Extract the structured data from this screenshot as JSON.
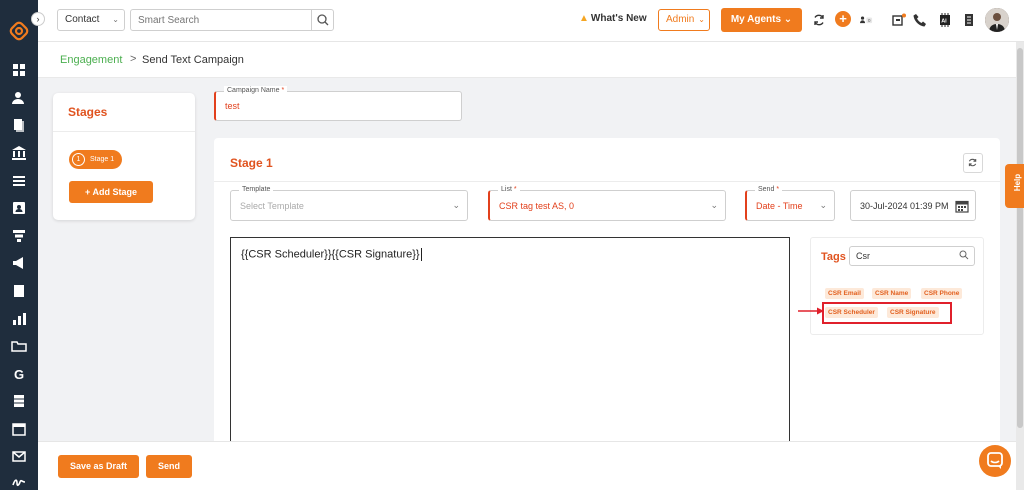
{
  "topbar": {
    "contact_select": "Contact",
    "search_placeholder": "Smart Search",
    "whats_new": "What's New",
    "admin_select": "Admin",
    "my_agents": "My Agents",
    "notification_count": "0"
  },
  "breadcrumb": {
    "parent": "Engagement",
    "separator": ">",
    "current": "Send Text Campaign"
  },
  "stages_panel": {
    "title": "Stages",
    "stage_number": "1",
    "stage_label": "Stage 1",
    "add_stage": "+ Add Stage"
  },
  "campaign_name": {
    "label": "Campaign Name",
    "required_mark": "*",
    "value": "test"
  },
  "stage_form": {
    "title": "Stage 1",
    "template_label": "Template",
    "template_placeholder": "Select Template",
    "list_label": "List",
    "list_value": "CSR tag test AS, 0",
    "send_label": "Send",
    "send_value": "Date - Time",
    "datetime_value": "30-Jul-2024 01:39 PM",
    "editor_text": "{{CSR Scheduler}}{{CSR Signature}}"
  },
  "tags_panel": {
    "title": "Tags",
    "search_value": "Csr",
    "tags": [
      "CSR Email",
      "CSR Name",
      "CSR Phone",
      "CSR Scheduler",
      "CSR Signature"
    ]
  },
  "footer": {
    "save_draft": "Save as Draft",
    "send": "Send"
  },
  "help_tab": "Help",
  "colors": {
    "accent": "#f07b1e",
    "title_orange": "#e0531f",
    "breadcrumb_green": "#4caf50",
    "sidebar_bg": "#1f2d3d",
    "highlight_red": "#e0202b"
  }
}
